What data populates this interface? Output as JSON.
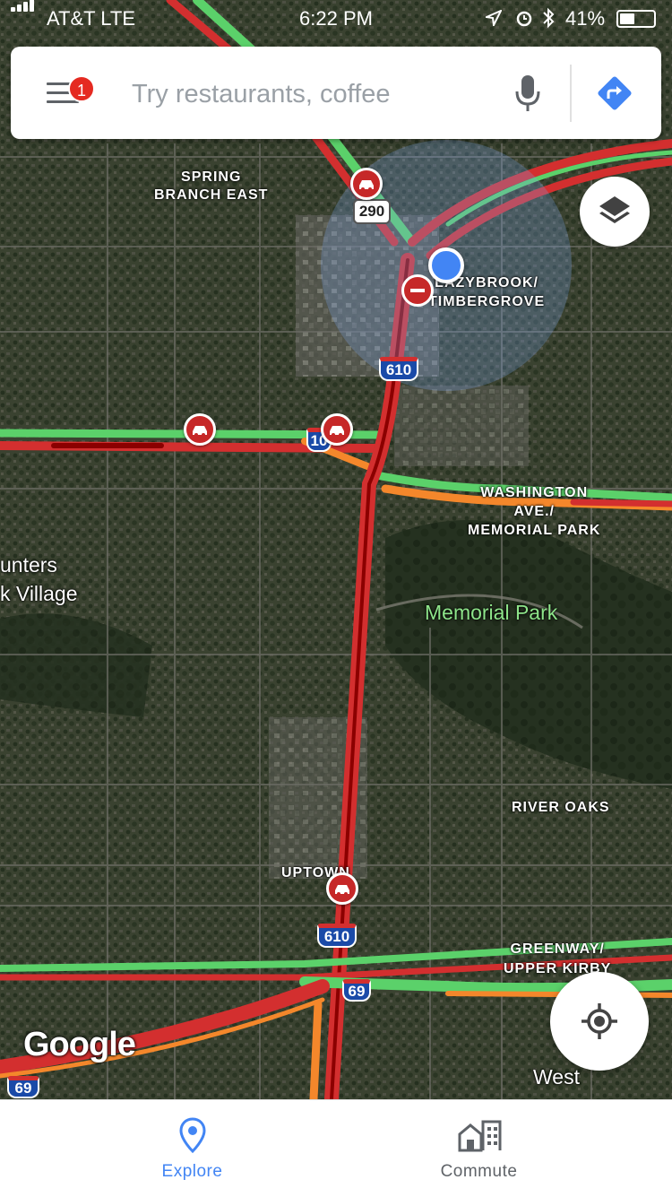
{
  "status_bar": {
    "carrier": "AT&T  LTE",
    "time": "6:22 PM",
    "battery_percent": "41%"
  },
  "search": {
    "placeholder": "Try restaurants, coffee",
    "notification_count": "1"
  },
  "map": {
    "labels": {
      "spring_branch_east_1": "SPRING",
      "spring_branch_east_2": "BRANCH EAST",
      "lazybrook_1": "LAZYBROOK/",
      "lazybrook_2": "TIMBERGROVE",
      "washington_1": "WASHINGTON",
      "washington_2": "AVE./",
      "washington_3": "MEMORIAL PARK",
      "hunters_1": "unters",
      "hunters_2": "k Village",
      "memorial_park": "Memorial Park",
      "river_oaks": "RIVER OAKS",
      "uptown": "UPTOWN",
      "greenway_1": "GREENWAY/",
      "greenway_2": "UPPER KIRBY",
      "west": "West"
    },
    "shields": {
      "us290": "290",
      "i610_north": "610",
      "i10": "10",
      "i610_south": "610",
      "us69_center": "69",
      "us69_left": "69"
    },
    "attribution": "Google",
    "traffic_colors": {
      "heavy": "#d32f2f",
      "severe": "#8b0000",
      "moderate": "#f4872b",
      "free": "#5bd16a"
    },
    "icons": [
      "incident-icon",
      "road-closure-icon",
      "layers-icon",
      "my-location-icon",
      "directions-icon",
      "microphone-icon",
      "menu-icon"
    ]
  },
  "bottom_nav": {
    "explore_label": "Explore",
    "commute_label": "Commute",
    "active_tab": "Explore",
    "active_color": "#4285f4"
  }
}
